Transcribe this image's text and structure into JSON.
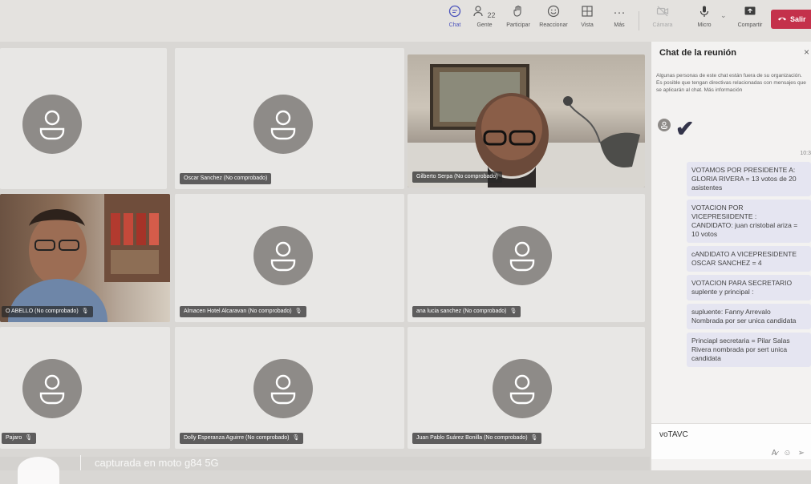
{
  "toolbar": {
    "chat_label": "Chat",
    "people_label": "Gente",
    "people_count": "22",
    "participate_label": "Participar",
    "react_label": "Reaccionar",
    "view_label": "Vista",
    "more_label": "Más",
    "camera_label": "Cámara",
    "mic_label": "Micro",
    "share_label": "Compartir",
    "leave_label": "Salir",
    "leave_color": "#c4314b",
    "accent_color": "#4b53bc"
  },
  "participants": [
    {
      "name": ""
    },
    {
      "name": "Oscar Sanchez (No comprobado)"
    },
    {
      "name": "Gilberto Serpa (No comprobado)"
    },
    {
      "name": "O ABELLO (No comprobado)"
    },
    {
      "name": "Almacen Hotel Alcaravan (No comprobado)"
    },
    {
      "name": "ana lucia sanchez (No comprobado)"
    },
    {
      "name": "Pajaro"
    },
    {
      "name": "Dolly Esperanza Aguirre (No comprobado)"
    },
    {
      "name": "Juan Pablo Suárez Bonilla (No comprobado)"
    }
  ],
  "chat": {
    "title": "Chat de la reunión",
    "close_icon": "×",
    "notice": "Algunas personas de este chat están fuera de su organización. Es posible que tengan directivas relacionadas con mensajes que se aplicarán al chat. Más información",
    "time": "10:3",
    "messages": [
      "VOTAMOS  POR PRESIDENTE  A: GLORIA RIVERA =  13 votos de 20 asistentes",
      "VOTACION POR VICEPRESIIDENTE :\n CANDIDATO: juan cristobal ariza =  10 votos",
      "cANDIDATO A VICEPRESIDENTE  OSCAR SANCHEZ = 4",
      "VOTACION PARA SECRETARIO suplente y principal  :",
      "supluente: Fanny Arrevalo\n Nombrada  por ser unica candidata",
      "Princiapl secretaria = Pilar Salas Rivera  nombrada por sert unica candidata"
    ],
    "compose_value": "voTAVC"
  },
  "footer": {
    "text": "capturada en moto g84 5G"
  }
}
